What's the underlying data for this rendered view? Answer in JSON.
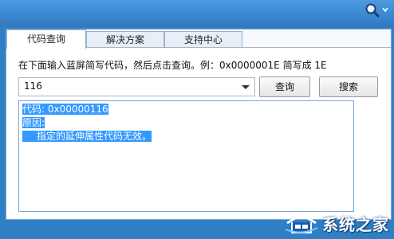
{
  "tabs": [
    {
      "label": "代码查询",
      "active": true
    },
    {
      "label": "解决方案",
      "active": false
    },
    {
      "label": "支持中心",
      "active": false
    }
  ],
  "hint": "在下面输入蓝屏简写代码，然后点击查询。例：0x0000001E 简写成 1E",
  "code_input": {
    "value": "116"
  },
  "buttons": {
    "query": "查询",
    "search": "搜索"
  },
  "result": {
    "code_line": "代码: 0x00000116",
    "reason_label": "原因:",
    "reason_text": "指定的延伸属性代码无效。"
  },
  "watermark": {
    "text": "系统之家"
  },
  "colors": {
    "titlebar": "#3a86cf",
    "selection": "#3399ff"
  },
  "icons": {
    "title": "search-icon"
  }
}
